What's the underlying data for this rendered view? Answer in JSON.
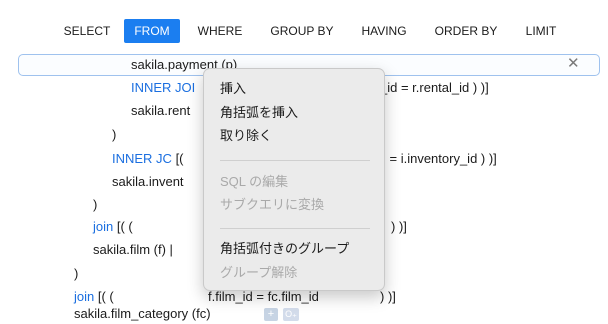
{
  "tabs": [
    "SELECT",
    "FROM",
    "WHERE",
    "GROUP BY",
    "HAVING",
    "ORDER BY",
    "LIMIT"
  ],
  "active_tab": "FROM",
  "colors": {
    "accent": "#1b7ef0",
    "keyword": "#1b6fe0"
  },
  "clear_symbol": "✕",
  "code": {
    "line1": "sakila.payment  (p)",
    "line2_kw": "INNER JOI",
    "line2_rest": "_id = r.rental_id     ) )]",
    "line3": "sakila.rent",
    "line4": ")",
    "line5_kw": "INNER JC",
    "line5_rest": " [(",
    "line5_tail": "l = i.inventory_id     ) )]",
    "line6": "sakila.invent",
    "line7": ")",
    "line8_kw": "join",
    "line8_rest": "  [(     (",
    "line8_tail": ") )]",
    "line9": "sakila.film  (f)  |",
    "line10": ")",
    "line11_kw": "join",
    "line11_rest": "  [(     (",
    "line11_mid": "f.film_id = fc.film_id",
    "line11_tail": ") )]",
    "line12": "sakila.film_category  (fc)",
    "chip_plus": "+",
    "chip_link": "O₊"
  },
  "menu": {
    "insert": "挿入",
    "insert_bracket": "角括弧を挿入",
    "remove": "取り除く",
    "edit_sql": "SQL の編集",
    "to_subquery": "サブクエリに変換",
    "group_bracket": "角括弧付きのグループ",
    "ungroup": "グループ解除"
  }
}
